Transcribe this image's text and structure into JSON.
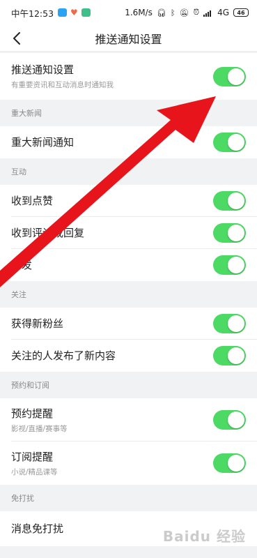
{
  "status_bar": {
    "time": "中午12:53",
    "net_speed": "1.6M/s",
    "network": "4G",
    "battery": "46"
  },
  "header": {
    "title": "推送通知设置"
  },
  "colors": {
    "toggle_on": "#4cd964",
    "arrow": "#e8141b"
  },
  "top_row": {
    "label": "推送通知设置",
    "sub": "有重要资讯和互动消息时通知我",
    "on": true
  },
  "sections": [
    {
      "title": "重大新闻",
      "items": [
        {
          "label": "重大新闻通知",
          "on": true
        }
      ]
    },
    {
      "title": "互动",
      "items": [
        {
          "label": "收到点赞",
          "on": true
        },
        {
          "label": "收到评论或回复",
          "on": true
        },
        {
          "label": "转发",
          "on": true
        }
      ]
    },
    {
      "title": "关注",
      "items": [
        {
          "label": "获得新粉丝",
          "on": true
        },
        {
          "label": "关注的人发布了新内容",
          "on": true
        }
      ]
    },
    {
      "title": "预约和订阅",
      "items": [
        {
          "label": "预约提醒",
          "sub": "影视/直播/赛事等",
          "on": true
        },
        {
          "label": "订阅提醒",
          "sub": "小说/精品课等",
          "on": true
        }
      ]
    },
    {
      "title": "免打扰",
      "items": [
        {
          "label": "消息免打扰"
        }
      ]
    }
  ],
  "watermark": "Baidu 经验"
}
